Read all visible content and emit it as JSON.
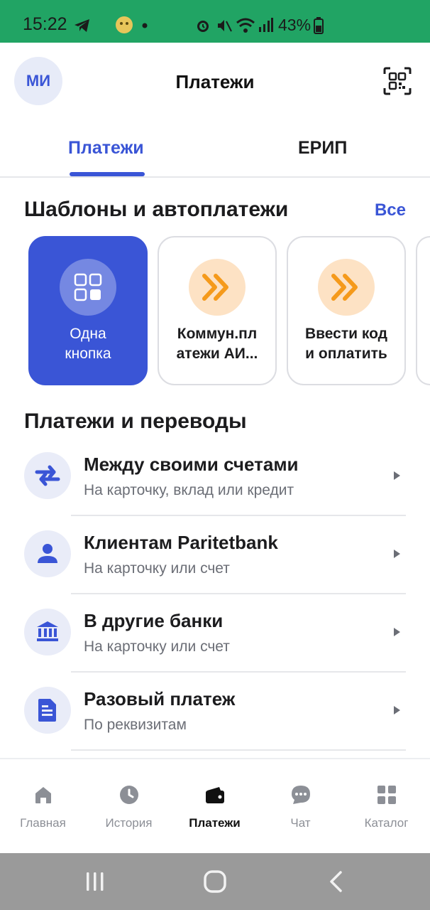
{
  "status_bar": {
    "time": "15:22",
    "battery_percent_label": "43%",
    "icons": [
      "telegram-icon",
      "avatar-sticker-icon",
      "dot-icon",
      "alarm-icon",
      "mute-icon",
      "wifi-icon",
      "signal-icon",
      "battery-icon"
    ]
  },
  "header": {
    "avatar_initials": "МИ",
    "title": "Платежи",
    "qr_icon": "qr-code-icon"
  },
  "tabs": [
    {
      "label": "Платежи",
      "active": true
    },
    {
      "label": "ЕРИП",
      "active": false
    }
  ],
  "templates": {
    "title": "Шаблоны и автоплатежи",
    "all_link": "Все",
    "cards": [
      {
        "label_line1": "Одна",
        "label_line2": "кнопка",
        "icon": "grid-icon",
        "active": true
      },
      {
        "label_line1": "Коммун.пл",
        "label_line2": "атежи АИ...",
        "icon": "double-chevron-icon",
        "active": false
      },
      {
        "label_line1": "Ввести код",
        "label_line2": "и оплатить",
        "icon": "double-chevron-icon",
        "active": false
      }
    ]
  },
  "transfers": {
    "title": "Платежи и переводы",
    "items": [
      {
        "title": "Между своими счетами",
        "subtitle": "На карточку, вклад или кредит",
        "icon": "transfer-arrows-icon"
      },
      {
        "title": "Клиентам Paritetbank",
        "subtitle": "На карточку или счет",
        "icon": "person-icon"
      },
      {
        "title": "В другие банки",
        "subtitle": "На карточку или счет",
        "icon": "bank-icon"
      },
      {
        "title": "Разовый платеж",
        "subtitle": "По реквизитам",
        "icon": "document-icon"
      }
    ]
  },
  "bottom_nav": [
    {
      "label": "Главная",
      "icon": "home-icon",
      "active": false
    },
    {
      "label": "История",
      "icon": "clock-icon",
      "active": false
    },
    {
      "label": "Платежи",
      "icon": "wallet-icon",
      "active": true
    },
    {
      "label": "Чат",
      "icon": "chat-icon",
      "active": false
    },
    {
      "label": "Каталог",
      "icon": "catalog-grid-icon",
      "active": false
    }
  ],
  "colors": {
    "accent": "#3a55d6",
    "status_bar": "#21a464",
    "orange": "#f59a1b",
    "orange_bg": "#fde2c4"
  }
}
